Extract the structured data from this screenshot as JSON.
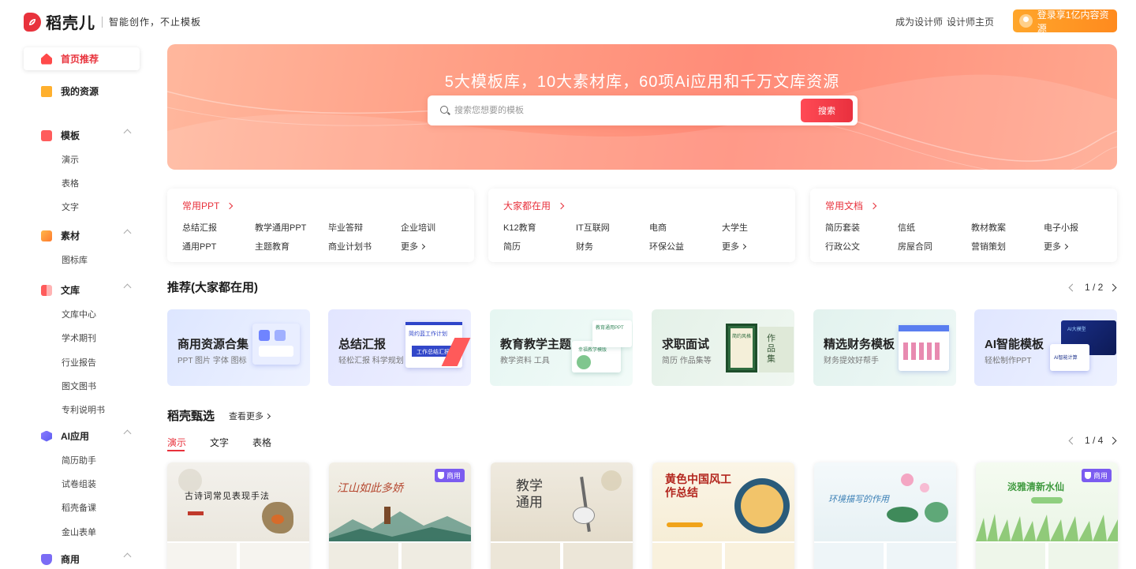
{
  "header": {
    "logo_text": "稻壳儿",
    "slogan": "智能创作，不止模板",
    "links": [
      "成为设计师",
      "设计师主页"
    ],
    "login_label": "登录享1亿内容资源"
  },
  "sidebar": {
    "home": "首页推荐",
    "resources": "我的资源",
    "groups": [
      {
        "label": "模板",
        "items": [
          "演示",
          "表格",
          "文字"
        ]
      },
      {
        "label": "素材",
        "items": [
          "图标库"
        ]
      },
      {
        "label": "文库",
        "items": [
          "文库中心",
          "学术期刊",
          "行业报告",
          "图文图书",
          "专利说明书"
        ]
      },
      {
        "label": "AI应用",
        "items": [
          "简历助手",
          "试卷组装",
          "稻壳备课",
          "金山表单"
        ]
      },
      {
        "label": "商用",
        "items": []
      }
    ]
  },
  "hero": {
    "title": "5大模板库，10大素材库，60项Ai应用和千万文库资源",
    "search_placeholder": "搜索您想要的模板",
    "search_button": "搜索"
  },
  "categories": [
    {
      "title": "常用PPT",
      "items": [
        "总结汇报",
        "教学通用PPT",
        "毕业答辩",
        "企业培训",
        "通用PPT",
        "主题教育",
        "商业计划书",
        "更多"
      ]
    },
    {
      "title": "大家都在用",
      "items": [
        "K12教育",
        "IT互联网",
        "电商",
        "大学生",
        "简历",
        "财务",
        "环保公益",
        "更多"
      ]
    },
    {
      "title": "常用文档",
      "items": [
        "简历套装",
        "信纸",
        "教材教案",
        "电子小报",
        "行政公文",
        "房屋合同",
        "营销策划",
        "更多"
      ]
    }
  ],
  "recommend": {
    "title": "推荐(大家都在用)",
    "page": "1 / 2",
    "cards": [
      {
        "title": "商用资源合集",
        "sub": "PPT 图片 字体 图标"
      },
      {
        "title": "总结汇报",
        "sub": "轻松汇报 科学规划"
      },
      {
        "title": "教育教学主题",
        "sub": "教学资料 工具"
      },
      {
        "title": "求职面试",
        "sub": "简历 作品集等"
      },
      {
        "title": "精选财务模板",
        "sub": "财务提效好帮手"
      },
      {
        "title": "AI智能模板",
        "sub": "轻松制作PPT"
      }
    ],
    "art_text": {
      "plan": "简约蓝工作计划",
      "summary": "工作总结汇报",
      "edu": "教育通用PPT",
      "edu2": "幸福教学模版",
      "resume": "简约风格",
      "works": "作品集",
      "ai_badge": "AI大模型",
      "ai_card": "AI智能计算"
    }
  },
  "selection": {
    "title": "稻壳甄选",
    "see_more": "查看更多",
    "page": "1 / 4",
    "tabs": [
      "演示",
      "文字",
      "表格"
    ],
    "badge": "商用",
    "thumbs": [
      {
        "title": "古诗词常见表现手法"
      },
      {
        "title": "江山如此多娇"
      },
      {
        "title": "教学通用"
      },
      {
        "title": "黄色中国风工作总结"
      },
      {
        "title": "环境描写的作用"
      },
      {
        "title": "淡雅清新水仙"
      }
    ]
  },
  "colors": {
    "accent": "#e8323c",
    "login": "#ff9a26",
    "badge": "#7b5cf0"
  }
}
